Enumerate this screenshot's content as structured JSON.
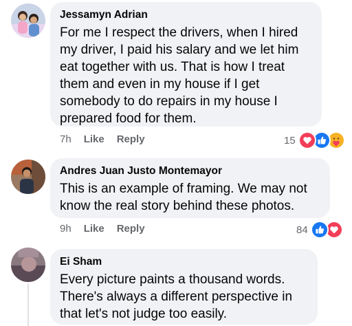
{
  "comments": [
    {
      "author": "Jessamyn Adrian",
      "text": "For me I respect the drivers, when I hired my driver, I paid his salary and we let him eat together with us. That is how I treat them and even in my house if I get somebody to do repairs in my house I prepared food for them.",
      "time": "7h",
      "like_label": "Like",
      "reply_label": "Reply",
      "reaction_count": "15",
      "reactions": [
        "love-icon",
        "like-icon",
        "care-icon"
      ]
    },
    {
      "author": "Andres Juan Justo Montemayor",
      "text": "This is an example of framing. We may not know the real story behind these photos.",
      "time": "9h",
      "like_label": "Like",
      "reply_label": "Reply",
      "reaction_count": "84",
      "reactions": [
        "like-icon",
        "love-icon"
      ]
    },
    {
      "author": "Ei Sham",
      "text": "Every picture paints a thousand words. There's always a different perspective in that let's not judge too easily."
    }
  ],
  "colors": {
    "bubble": "#f0f2f5",
    "meta_text": "#65676b",
    "like_blue": "#1877f2",
    "love_red": "#f33e58",
    "care_yellow": "#f7b125"
  }
}
